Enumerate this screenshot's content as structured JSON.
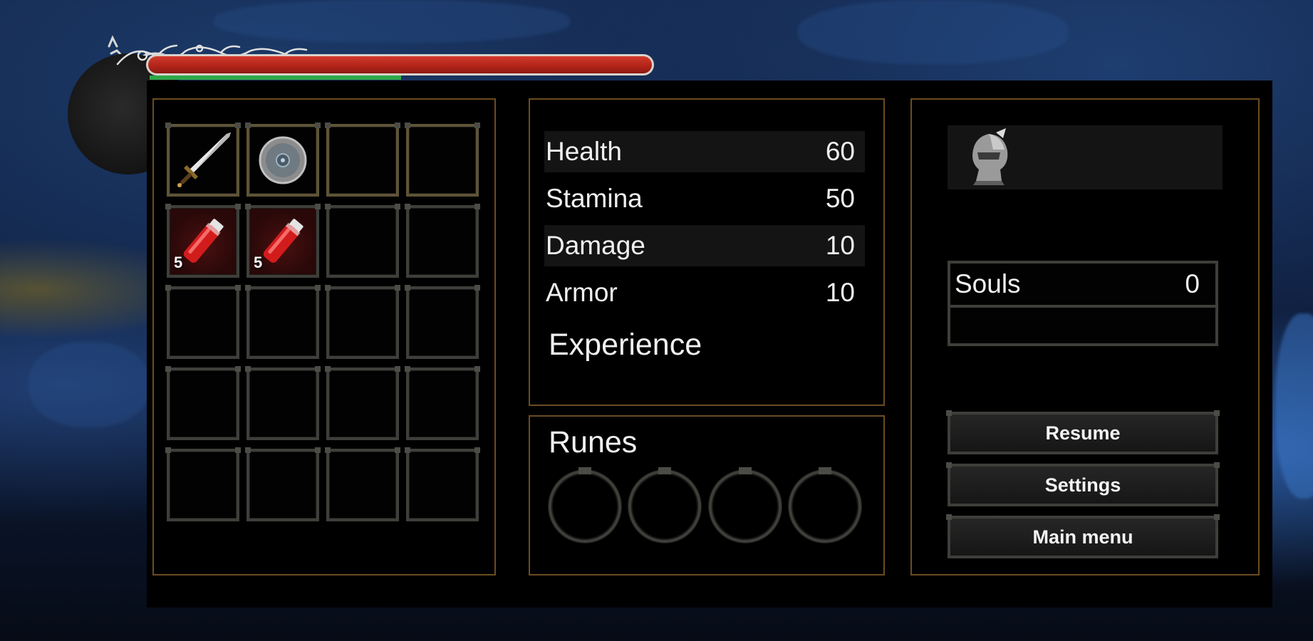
{
  "hud": {
    "health_fill": 1.0,
    "stamina_fill": 0.5,
    "health_color": "#b32419",
    "stamina_color": "#2fa84a"
  },
  "inventory": {
    "slots": [
      {
        "item": "sword-icon",
        "count": ""
      },
      {
        "item": "round-shield-icon",
        "count": ""
      },
      {
        "item": "",
        "count": ""
      },
      {
        "item": "",
        "count": ""
      },
      {
        "item": "health-potion-icon",
        "count": "5"
      },
      {
        "item": "health-potion-icon",
        "count": "5"
      },
      {
        "item": "",
        "count": ""
      },
      {
        "item": "",
        "count": ""
      },
      {
        "item": "",
        "count": ""
      },
      {
        "item": "",
        "count": ""
      },
      {
        "item": "",
        "count": ""
      },
      {
        "item": "",
        "count": ""
      },
      {
        "item": "",
        "count": ""
      },
      {
        "item": "",
        "count": ""
      },
      {
        "item": "",
        "count": ""
      },
      {
        "item": "",
        "count": ""
      },
      {
        "item": "",
        "count": ""
      },
      {
        "item": "",
        "count": ""
      },
      {
        "item": "",
        "count": ""
      },
      {
        "item": "",
        "count": ""
      }
    ]
  },
  "stats": {
    "rows": [
      {
        "label": "Health",
        "value": "60"
      },
      {
        "label": "Stamina",
        "value": "50"
      },
      {
        "label": "Damage",
        "value": "10"
      },
      {
        "label": "Armor",
        "value": "10"
      }
    ],
    "experience_label": "Experience"
  },
  "runes": {
    "title": "Runes",
    "slots": [
      "",
      "",
      "",
      ""
    ]
  },
  "character": {
    "portrait_icon": "knight-portrait-icon",
    "souls_label": "Souls",
    "souls_value": "0"
  },
  "menu": {
    "resume": "Resume",
    "settings": "Settings",
    "main_menu": "Main menu"
  }
}
